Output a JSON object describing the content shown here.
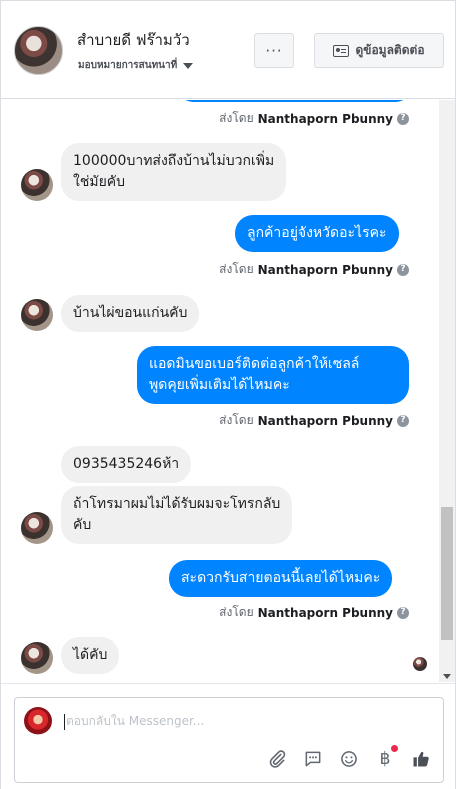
{
  "header": {
    "page_name": "สำบายดี ฟร๊ามวัว",
    "role_label": "มอบหมายการสนทนาที่",
    "more_label": "···",
    "contact_button_label": "ดูข้อมูลติดต่อ"
  },
  "messages": [
    {
      "dir": "out",
      "text": "",
      "sent_by_prefix": "ส่งโดย",
      "sent_by_name": "Nanthaporn Pbunny"
    },
    {
      "dir": "in",
      "lines": [
        "100000บาทส่งถึงบ้านไม่บวกเพิ่ม",
        "ใช่มัยคับ"
      ]
    },
    {
      "dir": "out",
      "text": "ลูกค้าอยู่จังหวัดอะไรคะ",
      "sent_by_prefix": "ส่งโดย",
      "sent_by_name": "Nanthaporn Pbunny"
    },
    {
      "dir": "in",
      "text": "บ้านไผ่ขอนแก่นคับ"
    },
    {
      "dir": "out",
      "lines": [
        "แอดมินขอเบอร์ติดต่อลูกค้าให้เซลล์",
        "พูดคุยเพิ่มเติมได้ไหมคะ"
      ],
      "sent_by_prefix": "ส่งโดย",
      "sent_by_name": "Nanthaporn Pbunny"
    },
    {
      "dir": "in",
      "text": "0935435246ห้า"
    },
    {
      "dir": "in",
      "lines": [
        "ถ้าโทรมาผมไม่ได้รับผมจะโทรกลับ",
        "คับ"
      ]
    },
    {
      "dir": "out",
      "text": "สะดวกรับสายตอนนี้เลยได้ไหมคะ",
      "sent_by_prefix": "ส่งโดย",
      "sent_by_name": "Nanthaporn Pbunny"
    },
    {
      "dir": "in",
      "text": "ได้คับ"
    }
  ],
  "help_glyph": "?",
  "composer": {
    "placeholder": "ตอบกลับใน Messenger...",
    "tools": [
      "paperclip-icon",
      "quick-reply-icon",
      "emoji-icon",
      "baht-payment-icon",
      "thumbs-up-icon"
    ],
    "baht_symbol": "฿"
  },
  "colors": {
    "outgoing_bubble": "#0084ff",
    "incoming_bubble": "#f1f0f0",
    "notification_dot": "#f02849"
  }
}
